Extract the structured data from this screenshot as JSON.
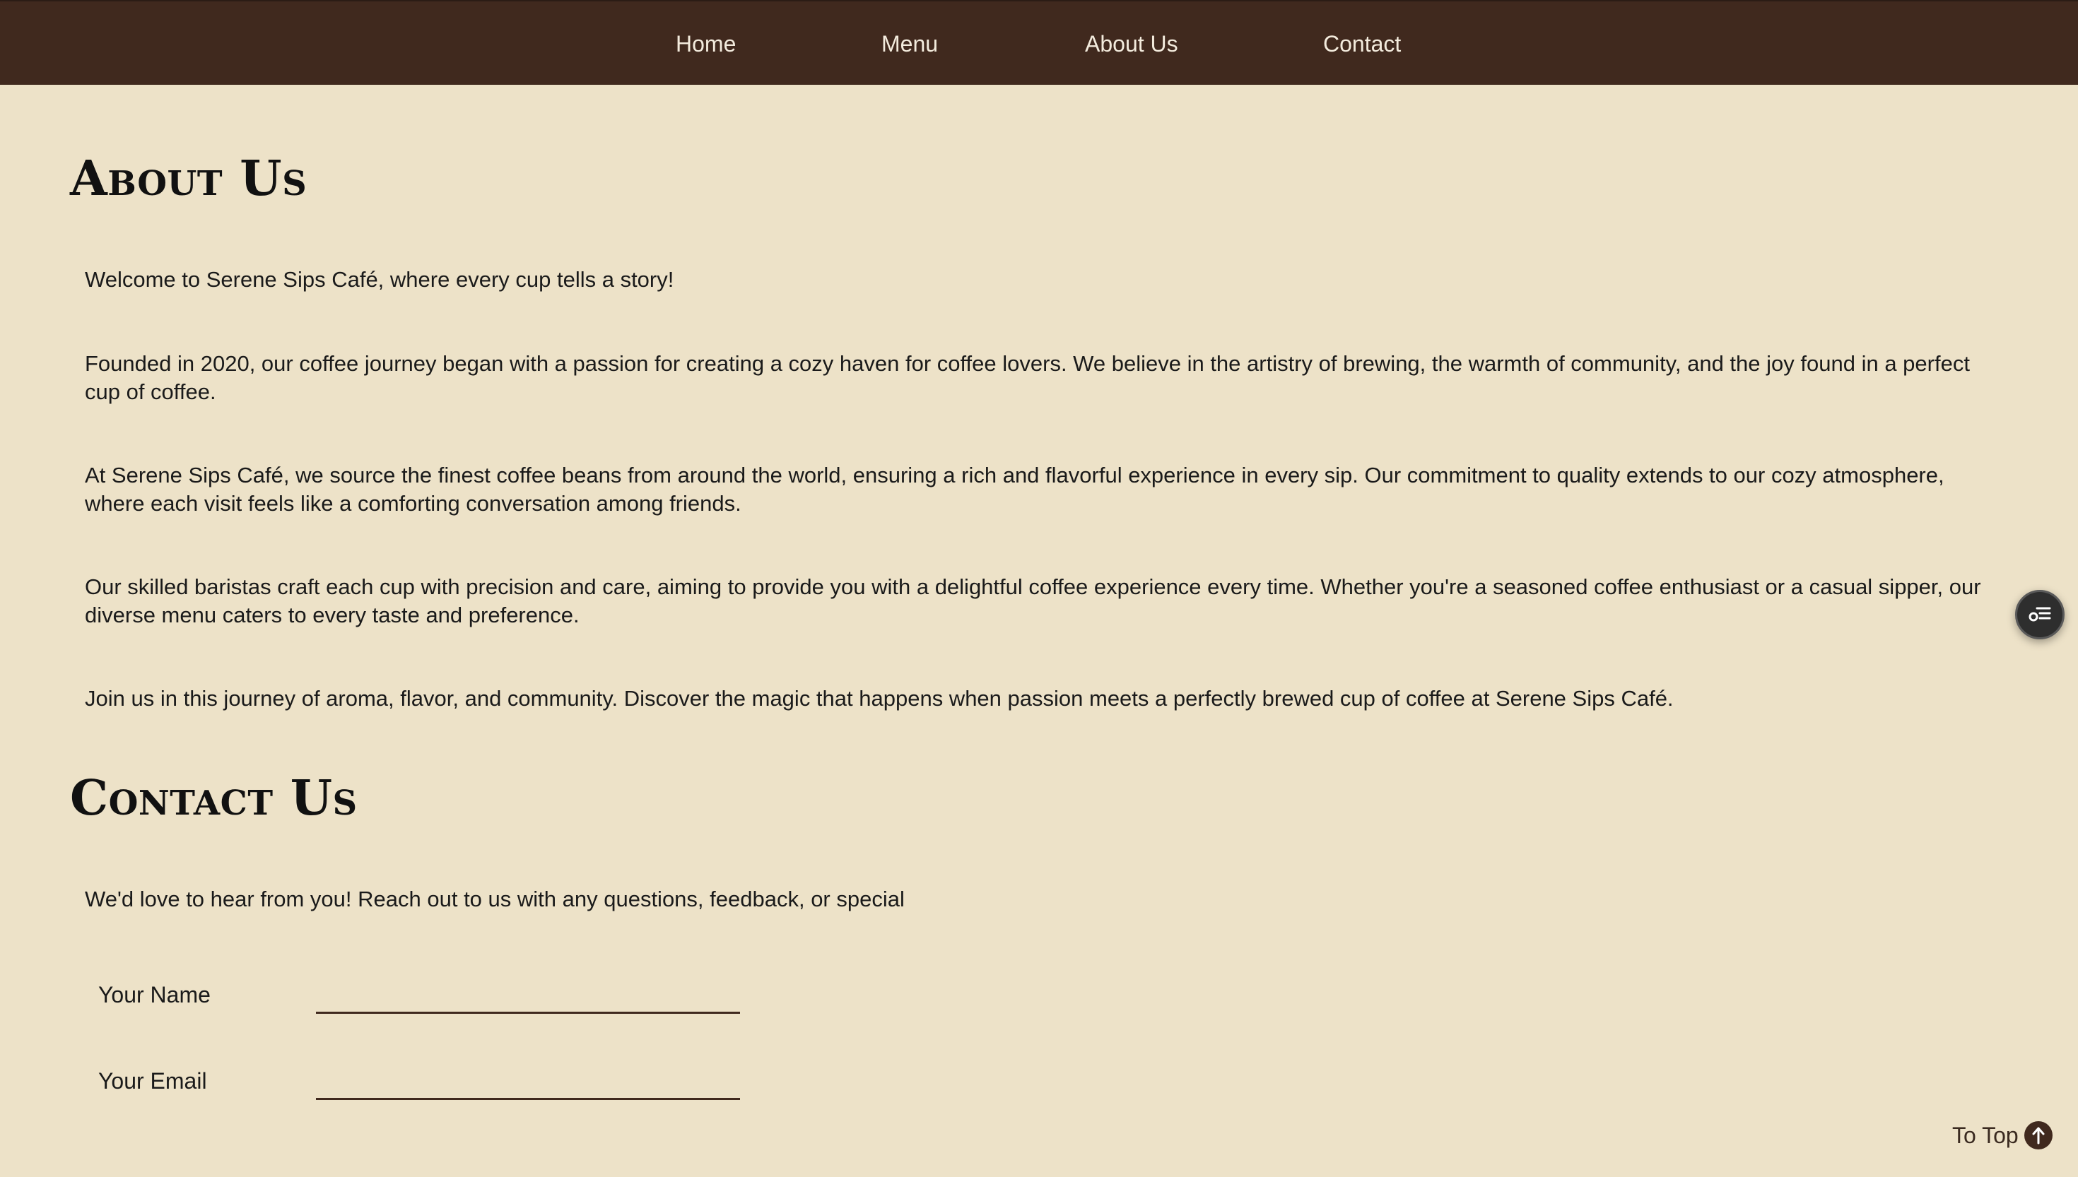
{
  "nav": {
    "items": [
      {
        "label": "Home"
      },
      {
        "label": "Menu"
      },
      {
        "label": "About Us"
      },
      {
        "label": "Contact"
      }
    ]
  },
  "about": {
    "title": "About Us",
    "paragraphs": [
      "Welcome to Serene Sips Café, where every cup tells a story!",
      "Founded in 2020, our coffee journey began with a passion for creating a cozy haven for coffee lovers. We believe in the artistry of brewing, the warmth of community, and the joy found in a perfect cup of coffee.",
      "At Serene Sips Café, we source the finest coffee beans from around the world, ensuring a rich and flavorful experience in every sip. Our commitment to quality extends to our cozy atmosphere, where each visit feels like a comforting conversation among friends.",
      "Our skilled baristas craft each cup with precision and care, aiming to provide you with a delightful coffee experience every time. Whether you're a seasoned coffee enthusiast or a casual sipper, our diverse menu caters to every taste and preference.",
      "Join us in this journey of aroma, flavor, and community. Discover the magic that happens when passion meets a perfectly brewed cup of coffee at Serene Sips Café."
    ]
  },
  "contact": {
    "title": "Contact Us",
    "intro": "We'd love to hear from you! Reach out to us with any questions, feedback, or special",
    "name_label": "Your Name",
    "name_value": "",
    "email_label": "Your Email",
    "email_value": ""
  },
  "to_top": {
    "label": "To Top",
    "icon": "arrow-up-icon"
  },
  "chat_button": {
    "icon": "chat-list-icon"
  },
  "colors": {
    "nav_bg": "#40291E",
    "page_bg": "#EDE2C8",
    "nav_text": "#F3EBDD",
    "accent": "#40291E"
  }
}
